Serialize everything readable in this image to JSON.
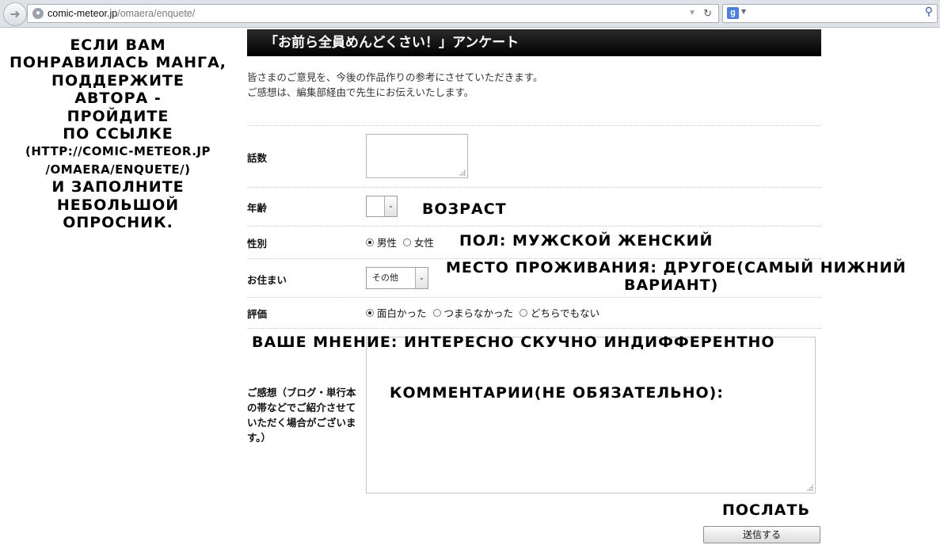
{
  "browser": {
    "url_host": "comic-meteor.jp",
    "url_path": "/omaera/enquete/",
    "search_engine_badge": "g",
    "icons": [
      "back-arrow-icon",
      "globe-icon",
      "dropdown-arrow-icon",
      "reload-icon",
      "google-icon",
      "search-magnifier-icon"
    ]
  },
  "sidebar_note": {
    "lines": [
      "Если вам",
      "понравилась манга,",
      "поддержите",
      "автора -",
      "пройдите",
      "по ссылке",
      "(http://comic-meteor.jp",
      "/omaera/enquete/)",
      "и заполните",
      "небольшой",
      "опросник."
    ]
  },
  "page": {
    "title": "「お前ら全員めんどくさい！」アンケート",
    "intro_line1": "皆さまのご意見を、今後の作品作りの参考にさせていただきます。",
    "intro_line2": "ご感想は、編集部経由で先生にお伝えいたします。"
  },
  "form": {
    "episode_label": "話数",
    "age_label": "年齢",
    "age_value": "",
    "gender_label": "性別",
    "gender_options": [
      "男性",
      "女性"
    ],
    "gender_selected": 0,
    "residence_label": "お住まい",
    "residence_value": "その他",
    "rating_label": "評価",
    "rating_options": [
      "面白かった",
      "つまらなかった",
      "どちらでもない"
    ],
    "rating_selected": 0,
    "comment_label": "ご感想（ブログ・単行本の帯などでご紹介させていただく場合がございます。）",
    "comment_value": "",
    "submit_label": "送信する"
  },
  "translation_notes": {
    "age": "Возраст",
    "gender": "Пол: мужской женский",
    "residence_line1": "Место проживания: другое(самый нижний",
    "residence_line2": "вариант)",
    "rating": "Ваше мнение: интересно скучно индифферентно",
    "comment": "Комментарии(не обязательно):",
    "submit": "Послать"
  }
}
